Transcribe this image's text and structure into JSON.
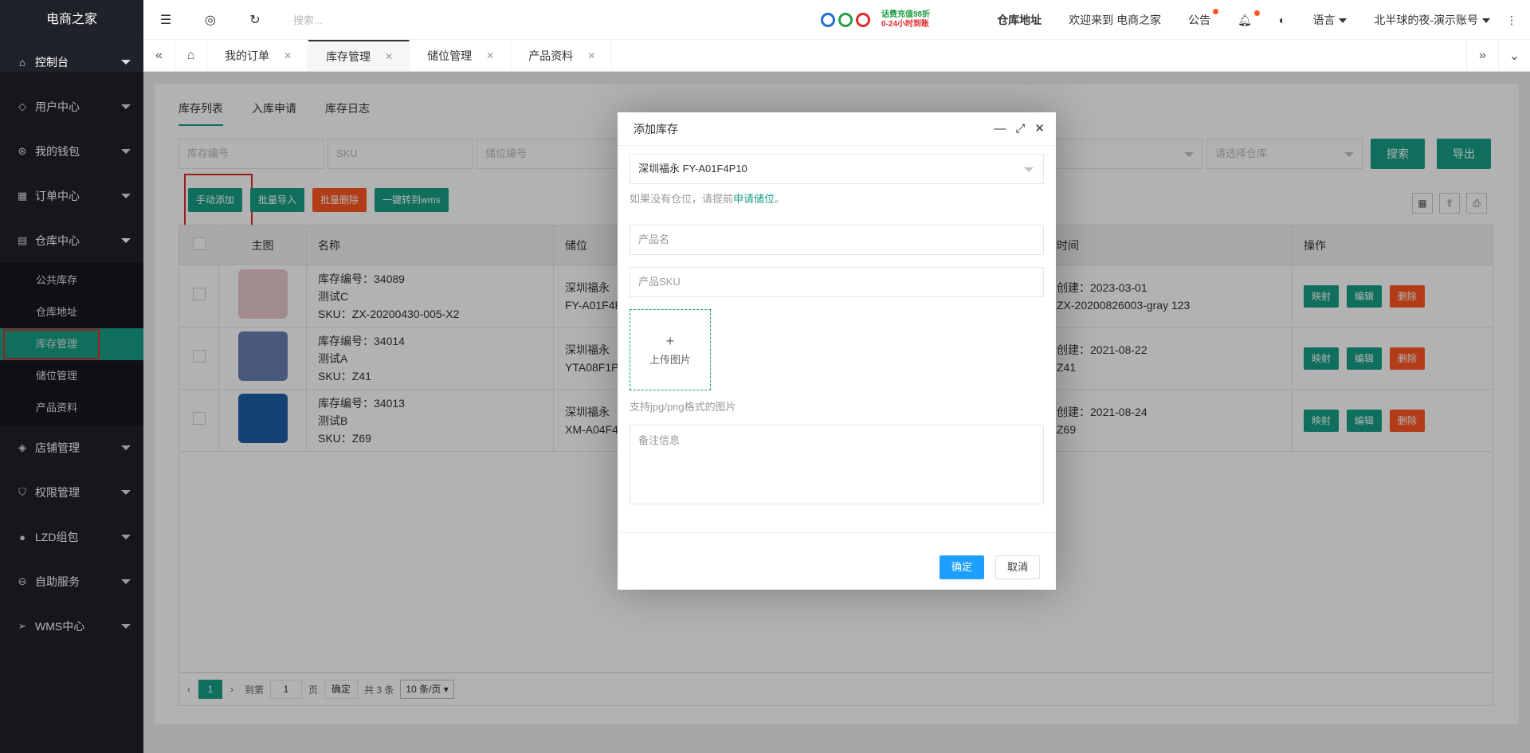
{
  "sidebar": {
    "logo": "电商之家",
    "items": [
      {
        "label": "控制台",
        "icon": "home-icon"
      },
      {
        "label": "用户中心",
        "icon": "diamond-icon"
      },
      {
        "label": "我的钱包",
        "icon": "wallet-icon"
      },
      {
        "label": "订单中心",
        "icon": "order-icon"
      },
      {
        "label": "仓库中心",
        "icon": "warehouse-icon"
      },
      {
        "label": "店铺管理",
        "icon": "shop-icon"
      },
      {
        "label": "权限管理",
        "icon": "shield-icon"
      },
      {
        "label": "LZD组包",
        "icon": "package-icon"
      },
      {
        "label": "自助服务",
        "icon": "service-icon"
      },
      {
        "label": "WMS中心",
        "icon": "send-icon"
      }
    ],
    "warehouse_sub": [
      "公共库存",
      "仓库地址",
      "库存管理",
      "储位管理",
      "产品资料"
    ]
  },
  "header": {
    "search_placeholder": "搜索...",
    "promo_line1": "话费充值98折",
    "promo_line2": "0-24小时到账",
    "warehouse_address": "仓库地址",
    "welcome": "欢迎来到 电商之家",
    "notice": "公告",
    "language": "语言",
    "account": "北半球的夜-演示账号"
  },
  "tabs": [
    "我的订单",
    "库存管理",
    "储位管理",
    "产品资料"
  ],
  "content": {
    "subtabs": [
      "库存列表",
      "入库申请",
      "库存日志"
    ],
    "filters": {
      "stock_no": "库存编号",
      "sku": "SKU",
      "slot_no": "储位编号",
      "warehouse": "请选择仓库",
      "search": "搜索",
      "export": "导出"
    },
    "toolbar": [
      "手动添加",
      "批量导入",
      "批量删除",
      "一键转到wms"
    ],
    "columns": [
      "主图",
      "名称",
      "储位",
      "时间",
      "操作"
    ],
    "rows": [
      {
        "no": "库存编号：34089",
        "name": "测试C",
        "sku": "SKU：ZX-20200430-005-X2",
        "slot1": "深圳福永",
        "slot2": "FY-A01F4P",
        "time": "创建：2023-03-01",
        "code": "ZX-20200826003-gray 123",
        "thumb_color": "#e9c9cf"
      },
      {
        "no": "库存编号：34014",
        "name": "测试A",
        "sku": "SKU：Z41",
        "slot1": "深圳福永",
        "slot2": "YTA08F1P",
        "time": "创建：2021-08-22",
        "code": "Z41",
        "thumb_color": "#6a7fb0"
      },
      {
        "no": "库存编号：34013",
        "name": "测试B",
        "sku": "SKU：Z69",
        "slot1": "深圳福永",
        "slot2": "XM-A04F4",
        "time": "创建：2021-08-24",
        "code": "Z69",
        "thumb_color": "#1f5fa8"
      }
    ],
    "actions": [
      "映射",
      "编辑",
      "删除"
    ],
    "pager": {
      "page": "1",
      "goto": "到第",
      "input": "1",
      "unit": "页",
      "confirm": "确定",
      "total": "共 3 条",
      "size": "10 条/页"
    }
  },
  "modal": {
    "title": "添加库存",
    "select_value": "深圳福永 FY-A01F4P10",
    "tip_prefix": "如果没有仓位，请提前",
    "tip_link": "申请储位",
    "tip_suffix": "。",
    "product_name": "产品名",
    "product_sku": "产品SKU",
    "upload_plus": "+",
    "upload_label": "上传图片",
    "upload_tip": "支持jpg/png格式的图片",
    "remark": "备注信息",
    "ok": "确定",
    "cancel": "取消"
  },
  "colors": {
    "accent": "#16a085",
    "danger": "#ff5722",
    "primary": "#1e9fff",
    "sidebar": "#20222a"
  }
}
